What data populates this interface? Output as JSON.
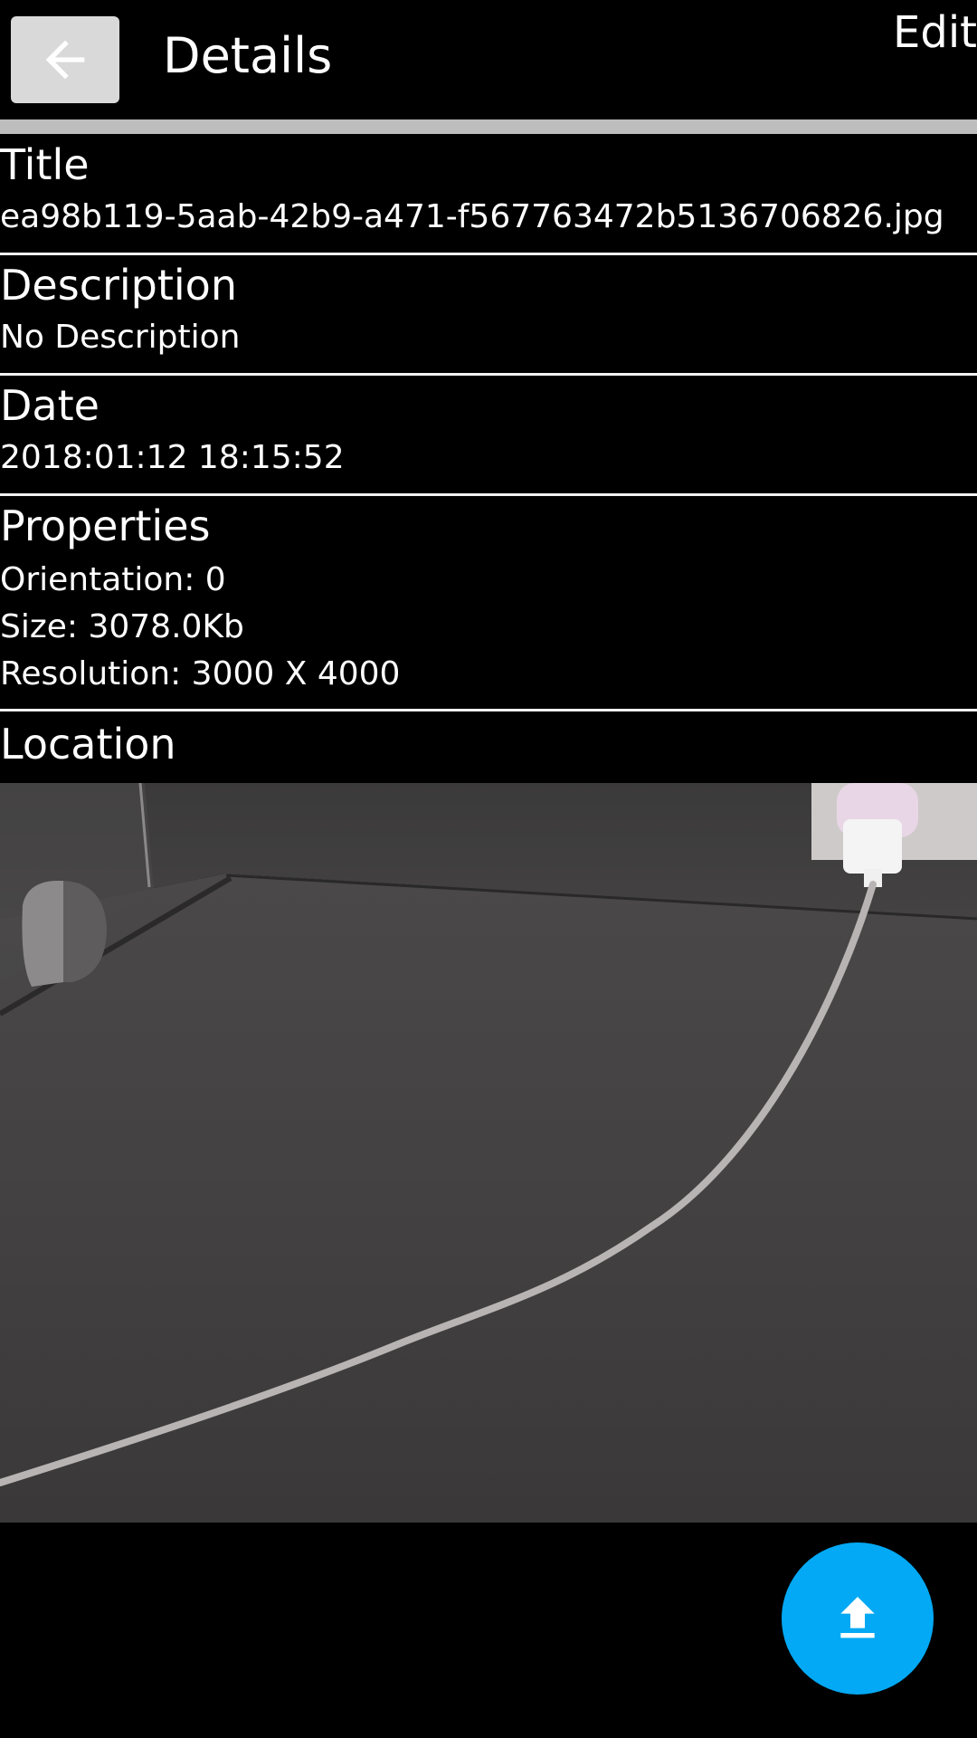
{
  "header": {
    "title": "Details",
    "edit_label": "Edit",
    "back_icon": "arrow-left-icon"
  },
  "details": {
    "title": {
      "heading": "Title",
      "value": "ea98b119-5aab-42b9-a471-f567763472b5136706826.jpg"
    },
    "description": {
      "heading": "Description",
      "value": "No Description"
    },
    "date": {
      "heading": "Date",
      "value": "2018:01:12 18:15:52"
    },
    "properties": {
      "heading": "Properties",
      "orientation": "Orientation: 0",
      "size": "Size: 3078.0Kb",
      "resolution": "Resolution: 3000 X  4000"
    },
    "location": {
      "heading": "Location"
    }
  },
  "fab": {
    "icon": "upload-icon",
    "color": "#03a9f4"
  },
  "colors": {
    "background": "#000000",
    "divider": "#bdbdbd",
    "back_button_bg": "#d9d9d9"
  }
}
